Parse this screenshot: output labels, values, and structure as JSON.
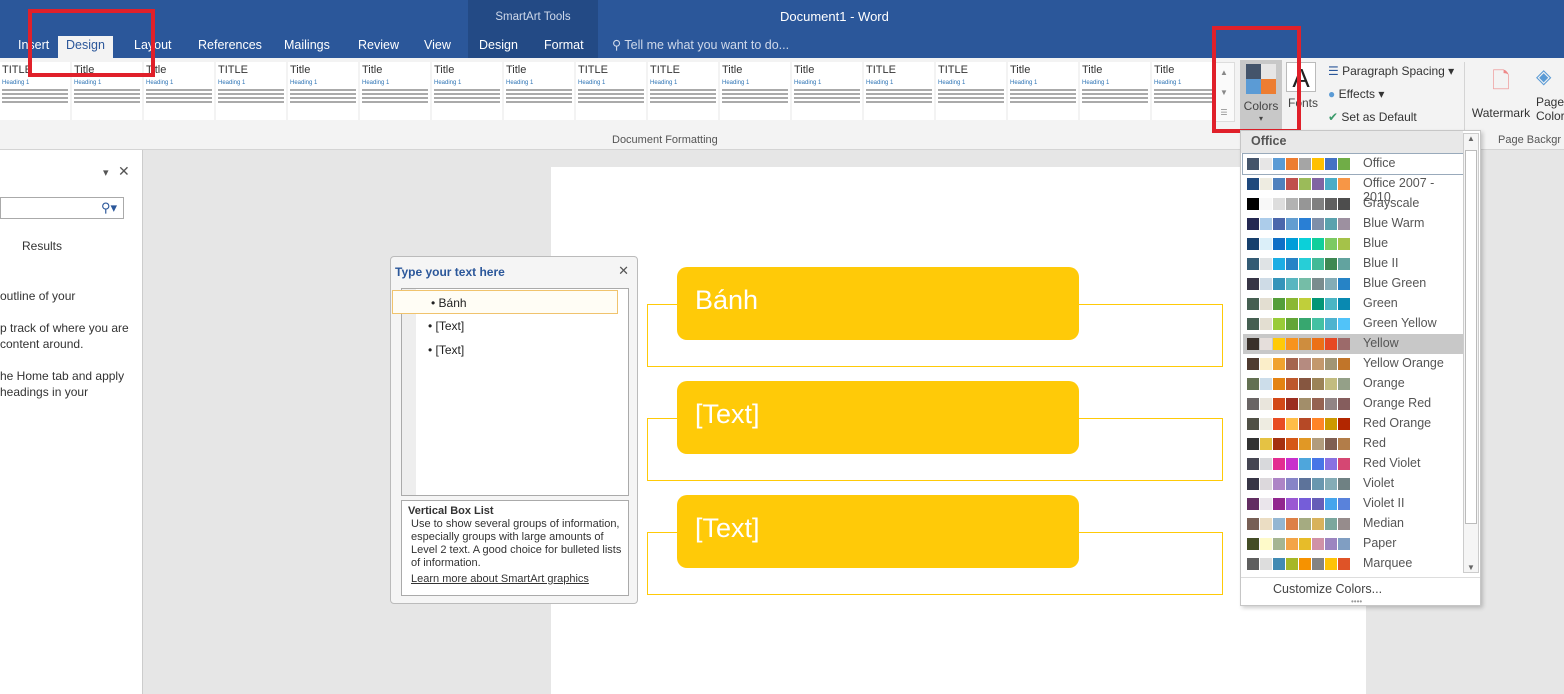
{
  "window": {
    "title": "Document1 - Word",
    "context_tab_group": "SmartArt Tools",
    "tell_me": "Tell me what you want to do..."
  },
  "tabs": [
    "Insert",
    "Design",
    "Layout",
    "References",
    "Mailings",
    "Review",
    "View",
    "Design",
    "Format"
  ],
  "ribbon": {
    "gallery_titles": [
      "TITLE",
      "Title",
      "Title",
      "TITLE",
      "Title",
      "Title",
      "Title",
      "Title",
      "TITLE",
      "TITLE",
      "Title",
      "Title",
      "TITLE",
      "TITLE",
      "Title",
      "Title",
      "Title"
    ],
    "gallery_heading": "Heading 1",
    "group_label": "Document Formatting",
    "colors": "Colors",
    "fonts": "Fonts",
    "paragraph_spacing": "Paragraph Spacing",
    "effects": "Effects",
    "set_default": "Set as Default",
    "watermark": "Watermark",
    "page_color": "Page Color",
    "page_bg_group": "Page Backgr"
  },
  "navpane": {
    "results": "Results",
    "lines": [
      "outline of your",
      "p track of where you are",
      "content around.",
      "he Home tab and apply",
      "headings in your"
    ]
  },
  "smartart": {
    "items": [
      "Bánh",
      "[Text]",
      "[Text]"
    ],
    "accent": "#ffca08"
  },
  "textpane": {
    "title": "Type your text here",
    "bullets": [
      "Bánh",
      "[Text]",
      "[Text]"
    ],
    "desc_title": "Vertical Box List",
    "desc": "Use to show several groups of information, especially groups with large amounts of Level 2 text. A good choice for bulleted lists of information.",
    "link": "Learn more about SmartArt graphics"
  },
  "colors_menu": {
    "header": "Office",
    "selected": "Yellow",
    "customize": "Customize Colors...",
    "themes": [
      {
        "name": "Office",
        "c": [
          "#44546a",
          "#e7e6e6",
          "#5b9bd5",
          "#ed7d31",
          "#a5a5a5",
          "#ffc000",
          "#4472c4",
          "#70ad47"
        ]
      },
      {
        "name": "Office 2007 - 2010",
        "c": [
          "#1f497d",
          "#eeece1",
          "#4f81bd",
          "#c0504d",
          "#9bbb59",
          "#8064a2",
          "#4bacc6",
          "#f79646"
        ]
      },
      {
        "name": "Grayscale",
        "c": [
          "#000000",
          "#f8f8f8",
          "#dddddd",
          "#b2b2b2",
          "#969696",
          "#808080",
          "#5f5f5f",
          "#4d4d4d"
        ]
      },
      {
        "name": "Blue Warm",
        "c": [
          "#242852",
          "#acccea",
          "#4a66ac",
          "#629dd1",
          "#297fd5",
          "#7f8fa9",
          "#5aa2ae",
          "#9d90a0"
        ]
      },
      {
        "name": "Blue",
        "c": [
          "#17406d",
          "#dbeff9",
          "#0f6fc6",
          "#009dd9",
          "#0bd0d9",
          "#10cf9b",
          "#7cca62",
          "#a5c249"
        ]
      },
      {
        "name": "Blue II",
        "c": [
          "#335b74",
          "#dfe3e5",
          "#1cade4",
          "#2683c6",
          "#27ced7",
          "#42ba97",
          "#3e8853",
          "#62a39f"
        ]
      },
      {
        "name": "Blue Green",
        "c": [
          "#373545",
          "#cedbe6",
          "#3494ba",
          "#58b6c0",
          "#75bda7",
          "#7a8c8e",
          "#84acb6",
          "#2683c6"
        ]
      },
      {
        "name": "Green",
        "c": [
          "#455f51",
          "#e3ded1",
          "#549e39",
          "#8ab833",
          "#c0cf3a",
          "#029676",
          "#4ab5c4",
          "#0989b1"
        ]
      },
      {
        "name": "Green Yellow",
        "c": [
          "#455f51",
          "#e3ded1",
          "#99cb38",
          "#63a537",
          "#37a76f",
          "#44c1a3",
          "#4eb3cf",
          "#51c3f9"
        ]
      },
      {
        "name": "Yellow",
        "c": [
          "#39302a",
          "#e5dedb",
          "#ffca08",
          "#f8931d",
          "#ce8d3e",
          "#ec7016",
          "#e64823",
          "#9c6a6a"
        ]
      },
      {
        "name": "Yellow Orange",
        "c": [
          "#4e3b30",
          "#fbeec9",
          "#f0a22e",
          "#a5644e",
          "#b58b80",
          "#c3986d",
          "#a19574",
          "#c17529"
        ]
      },
      {
        "name": "Orange",
        "c": [
          "#637052",
          "#ccddea",
          "#e48312",
          "#bd582c",
          "#865640",
          "#9b8357",
          "#c2bc80",
          "#94a088"
        ]
      },
      {
        "name": "Orange Red",
        "c": [
          "#696464",
          "#e9e5dc",
          "#d34817",
          "#9b2d1f",
          "#a28e6a",
          "#956251",
          "#918485",
          "#855d5d"
        ]
      },
      {
        "name": "Red Orange",
        "c": [
          "#505046",
          "#eeece1",
          "#e84c22",
          "#ffbd47",
          "#b64926",
          "#ff8427",
          "#cc9900",
          "#b22600"
        ]
      },
      {
        "name": "Red",
        "c": [
          "#323232",
          "#e5c243",
          "#a5300f",
          "#d55816",
          "#e19825",
          "#b19c7d",
          "#7f5f52",
          "#b27d49"
        ]
      },
      {
        "name": "Red Violet",
        "c": [
          "#454551",
          "#d8d9dc",
          "#e32d91",
          "#c830cc",
          "#4ea6dc",
          "#4775e7",
          "#8971e1",
          "#d54773"
        ]
      },
      {
        "name": "Violet",
        "c": [
          "#373545",
          "#dcd8dc",
          "#ad84c6",
          "#8784c7",
          "#5d739a",
          "#6997af",
          "#84acb6",
          "#6f8183"
        ]
      },
      {
        "name": "Violet II",
        "c": [
          "#632e62",
          "#eae5eb",
          "#92278f",
          "#9b57d3",
          "#755dd9",
          "#665eb8",
          "#45a5ed",
          "#5982db"
        ]
      },
      {
        "name": "Median",
        "c": [
          "#775f55",
          "#ebddc3",
          "#94b6d2",
          "#dd8047",
          "#a5ab81",
          "#d8b25c",
          "#7ba79d",
          "#968c8c"
        ]
      },
      {
        "name": "Paper",
        "c": [
          "#444d26",
          "#fefac9",
          "#a5b592",
          "#f3a447",
          "#e7bc29",
          "#d092a7",
          "#9c85c0",
          "#809ec2"
        ]
      },
      {
        "name": "Marquee",
        "c": [
          "#5e5e5e",
          "#dddddd",
          "#418ab3",
          "#a6b727",
          "#f69200",
          "#838383",
          "#fec306",
          "#df5327"
        ]
      }
    ]
  }
}
